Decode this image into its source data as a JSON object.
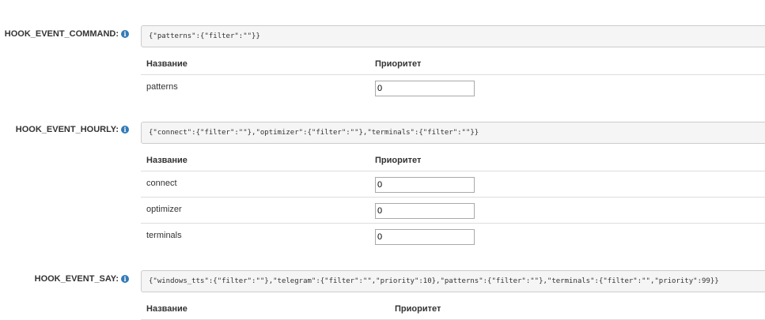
{
  "sections": [
    {
      "label": "HOOK_EVENT_COMMAND:",
      "json": "{\"patterns\":{\"filter\":\"\"}}",
      "col_name": "Название",
      "col_priority": "Приоритет",
      "rows": [
        {
          "name": "patterns",
          "priority": "0"
        }
      ]
    },
    {
      "label": "HOOK_EVENT_HOURLY:",
      "json": "{\"connect\":{\"filter\":\"\"},\"optimizer\":{\"filter\":\"\"},\"terminals\":{\"filter\":\"\"}}",
      "col_name": "Название",
      "col_priority": "Приоритет",
      "rows": [
        {
          "name": "connect",
          "priority": "0"
        },
        {
          "name": "optimizer",
          "priority": "0"
        },
        {
          "name": "terminals",
          "priority": "0"
        }
      ]
    },
    {
      "label": "HOOK_EVENT_SAY:",
      "json": "{\"windows_tts\":{\"filter\":\"\"},\"telegram\":{\"filter\":\"\",\"priority\":10},\"patterns\":{\"filter\":\"\"},\"terminals\":{\"filter\":\"\",\"priority\":99}}",
      "col_name": "Название",
      "col_priority": "Приоритет"
    }
  ],
  "info_icon": "info-circle-icon",
  "colors": {
    "accent": "#337ab7",
    "json_bg": "#f5f5f5",
    "border": "#dddddd"
  }
}
